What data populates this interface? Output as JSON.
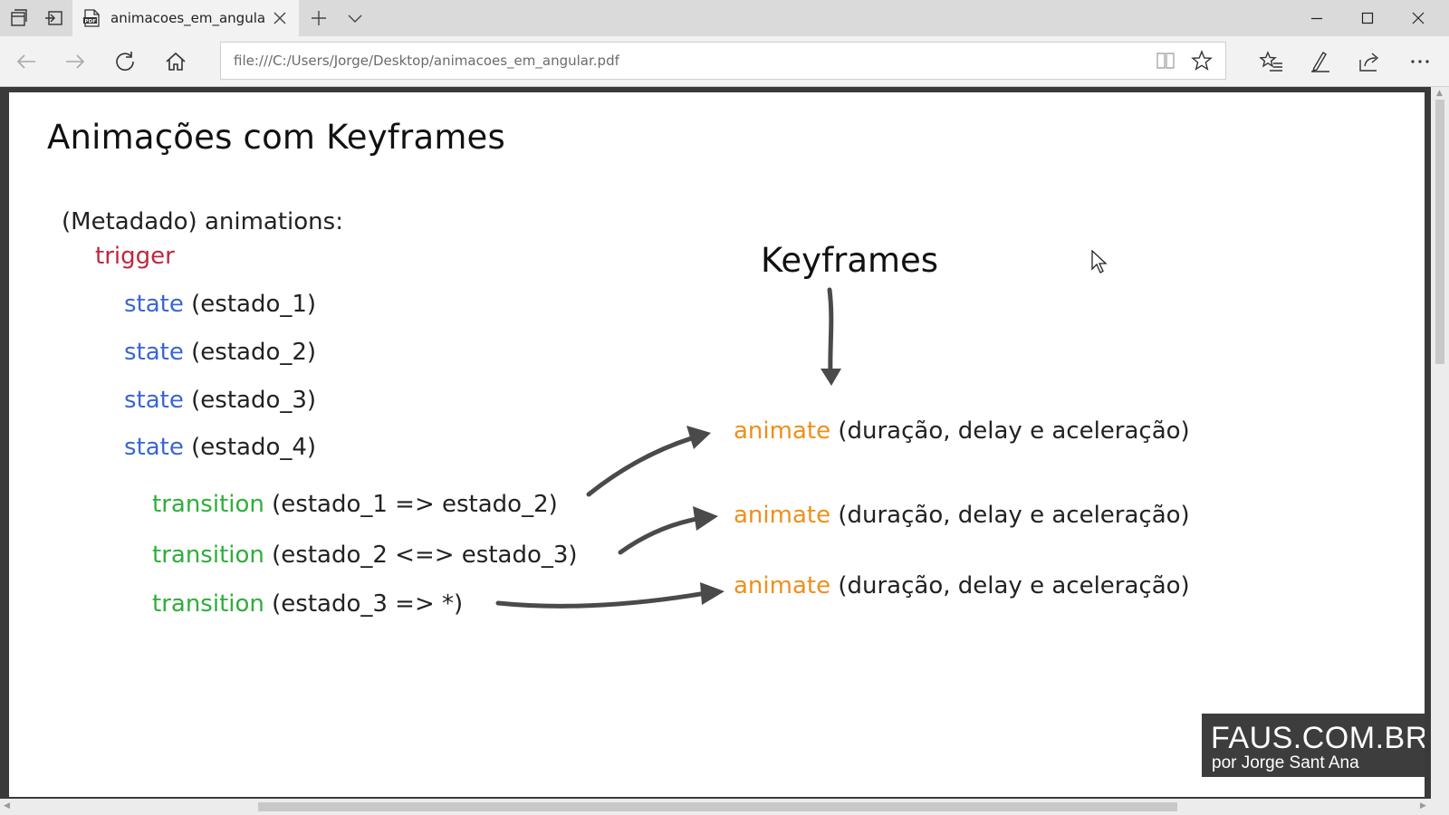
{
  "browser": {
    "tab": {
      "title": "animacoes_em_angular."
    },
    "address": {
      "url": "file:///C:/Users/Jorge/Desktop/animacoes_em_angular.pdf"
    }
  },
  "slide": {
    "title": "Animações com Keyframes",
    "code_header": "(Metadado) animations:",
    "trigger_kw": "trigger",
    "states": [
      {
        "kw": "state",
        "arg": "(estado_1)"
      },
      {
        "kw": "state",
        "arg": "(estado_2)"
      },
      {
        "kw": "state",
        "arg": "(estado_3)"
      },
      {
        "kw": "state",
        "arg": "(estado_4)"
      }
    ],
    "transitions": [
      {
        "kw": "transition",
        "arg": "(estado_1 => estado_2)"
      },
      {
        "kw": "transition",
        "arg": "(estado_2 <=> estado_3)"
      },
      {
        "kw": "transition",
        "arg": "(estado_3 => *)"
      }
    ],
    "keyframes_label": "Keyframes",
    "animates": [
      {
        "kw": "animate",
        "arg": "(duração, delay e aceleração)"
      },
      {
        "kw": "animate",
        "arg": "(duração, delay e aceleração)"
      },
      {
        "kw": "animate",
        "arg": "(duração, delay e aceleração)"
      }
    ],
    "colors": {
      "trigger": "#c0263d",
      "state": "#3a66d1",
      "transition": "#2fae3c",
      "animate": "#ef8f1a"
    }
  },
  "watermark": {
    "brand": "FAUS.COM.BR",
    "author": "por Jorge Sant Ana"
  },
  "icons": {
    "tabs_aside": "tabs-aside-icon",
    "set_aside": "set-tabs-aside-icon",
    "pdf": "pdf-file-icon",
    "close": "close-icon",
    "new_tab": "plus-icon",
    "tab_preview": "chevron-down-icon",
    "back": "back-arrow-icon",
    "forward": "forward-arrow-icon",
    "refresh": "refresh-icon",
    "home": "home-icon",
    "reading_view": "reading-view-icon",
    "favorite": "star-icon",
    "favorites_hub": "favorites-list-icon",
    "web_note": "pen-icon",
    "share": "share-icon",
    "more": "more-dots-icon",
    "minimize": "minimize-icon",
    "maximize": "maximize-icon"
  }
}
